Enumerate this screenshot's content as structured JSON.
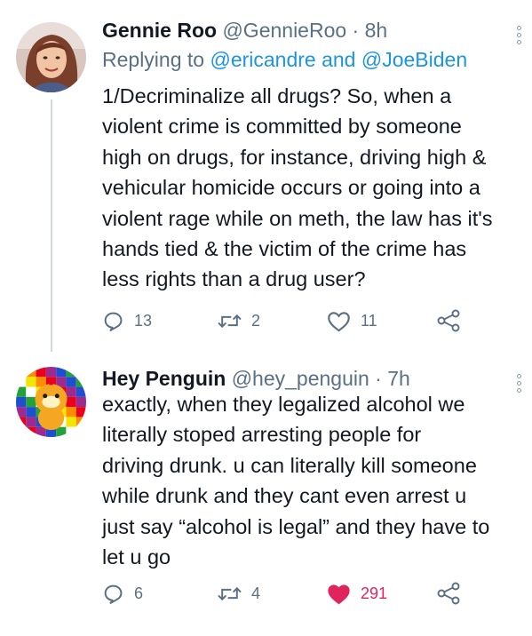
{
  "tweets": [
    {
      "name": "Gennie Roo",
      "handle": "@GennieRoo",
      "time": "8h",
      "replying_to_prefix": "Replying to ",
      "replying_to_1": "@ericandre",
      "replying_to_and": " and ",
      "replying_to_2": "@JoeBiden",
      "text_lines": [
        "1/Decriminalize all drugs? So, when a",
        "violent crime is committed by someone",
        "high on drugs, for instance, driving high &",
        "vehicular homicide occurs or going into a",
        "violent rage while on meth, the law has it's",
        "hands tied & the victim of the crime has",
        "less rights than a drug user?"
      ],
      "replies": "13",
      "retweets": "2",
      "likes": "11",
      "liked": false,
      "avatar_icon": "profile-photo"
    },
    {
      "name": "Hey Penguin",
      "handle": "@hey_penguin",
      "time": "7h",
      "text_lines": [
        "exactly, when they legalized alcohol we",
        "literally stoped arresting people for",
        "driving drunk. u can literally kill someone",
        "while drunk and they cant even arrest u",
        "just say “alcohol is legal” and they have to",
        "let u go"
      ],
      "replies": "6",
      "retweets": "4",
      "likes": "291",
      "liked": true,
      "avatar_icon": "pixel-flag-chick"
    }
  ],
  "separator": " · ",
  "colors": {
    "text": "#141823",
    "secondary": "#5b7083",
    "link": "#1b95e0",
    "like": "#e0245e",
    "thread_line": "#cfd9de"
  }
}
